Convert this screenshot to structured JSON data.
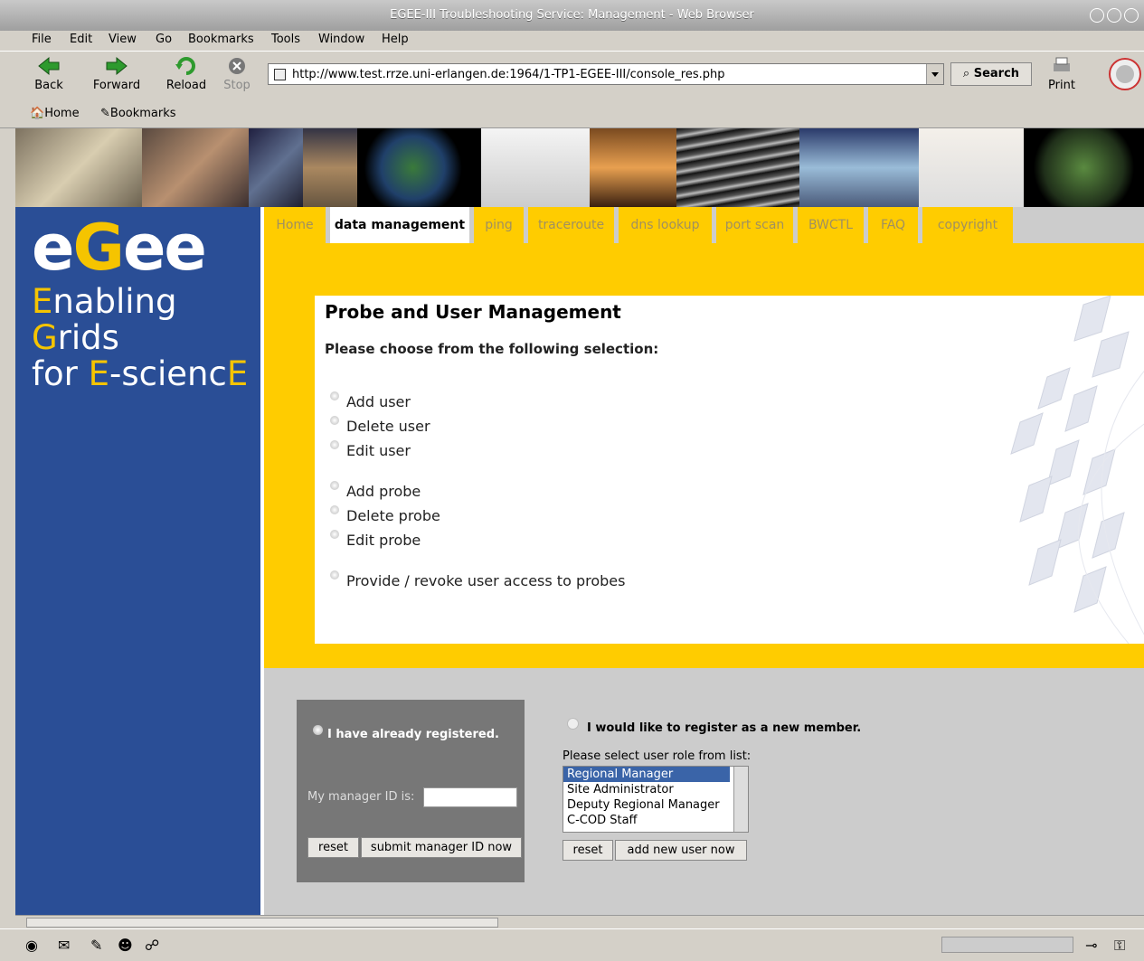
{
  "window": {
    "title": "EGEE-III Troubleshooting Service: Management - Web Browser"
  },
  "menu": [
    "File",
    "Edit",
    "View",
    "Go",
    "Bookmarks",
    "Tools",
    "Window",
    "Help"
  ],
  "nav": {
    "back": "Back",
    "forward": "Forward",
    "reload": "Reload",
    "stop": "Stop",
    "url": "http://www.test.rrze.uni-erlangen.de:1964/1-TP1-EGEE-III/console_res.php",
    "search": "Search",
    "print": "Print"
  },
  "bookmarks_bar": {
    "home": "Home",
    "bookmarks": "Bookmarks"
  },
  "logo": {
    "part1": "e",
    "part2": "G",
    "part3": "ee"
  },
  "tagline": {
    "line1_a": "E",
    "line1_b": "nabling ",
    "line1_c": "G",
    "line1_d": "rids",
    "line2_a": "for ",
    "line2_b": "E",
    "line2_c": "-scienc",
    "line2_d": "E"
  },
  "tabs": [
    "Home",
    "data management",
    "ping",
    "traceroute",
    "dns lookup",
    "port scan",
    "BWCTL",
    "FAQ",
    "copyright"
  ],
  "active_tab": "data management",
  "main": {
    "title": "Probe and User Management",
    "subtitle": "Please choose from the following selection:",
    "options": [
      "Add user",
      "Delete user",
      "Edit user",
      "Add probe",
      "Delete probe",
      "Edit probe",
      "Provide / revoke user access to probes"
    ]
  },
  "registered": {
    "label": "I have already registered.",
    "id_label": "My manager ID is:",
    "id_value": "",
    "reset": "reset",
    "submit": "submit manager ID now"
  },
  "new_member": {
    "label": "I would like to register as a new member.",
    "prompt": "Please select user role from list:",
    "roles": [
      "Regional Manager",
      "Site Administrator",
      "Deputy Regional Manager",
      "C-COD Staff"
    ],
    "selected_role": "Regional Manager",
    "reset": "reset",
    "submit": "add new user now"
  },
  "colors": {
    "sidebar": "#2a4e96",
    "accent": "#ffcc00",
    "logo_highlight": "#f5c400"
  }
}
